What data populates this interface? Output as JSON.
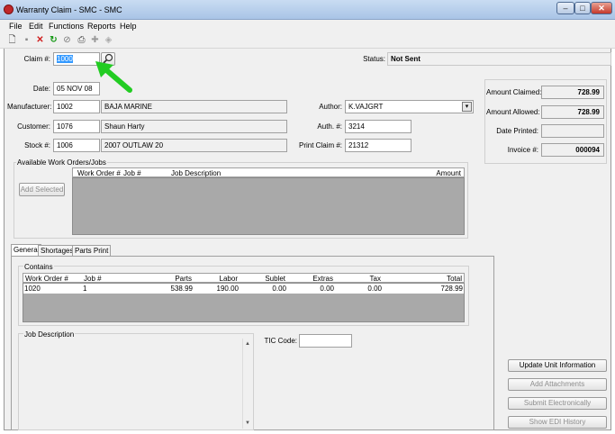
{
  "window": {
    "title": "Warranty Claim - SMC - SMC",
    "min": "–",
    "max": "□",
    "close": "✕"
  },
  "menu": {
    "file": "File",
    "edit": "Edit",
    "functions": "Functions",
    "reports": "Reports",
    "help": "Help"
  },
  "toolbar": {
    "new": "🗋",
    "save": "▪",
    "delete": "✕",
    "refresh": "↻",
    "cancel": "⊘",
    "print": "⎙",
    "add": "✚",
    "attach": "◈"
  },
  "header": {
    "claim_label": "Claim #:",
    "claim_value": "1000",
    "status_label": "Status:",
    "status_value": "Not Sent",
    "date_label": "Date:",
    "date_value": "05 NOV 08"
  },
  "info": {
    "manufacturer_label": "Manufacturer:",
    "manufacturer_code": "1002",
    "manufacturer_name": "BAJA MARINE",
    "customer_label": "Customer:",
    "customer_code": "1076",
    "customer_name": "Shaun Harty",
    "stock_label": "Stock #:",
    "stock_code": "1006",
    "stock_name": "2007 OUTLAW 20",
    "author_label": "Author:",
    "author_value": "K.VAJGRT",
    "auth_label": "Auth. #:",
    "auth_value": "3214",
    "print_claim_label": "Print Claim #:",
    "print_claim_value": "21312"
  },
  "amounts": {
    "claimed_label": "Amount Claimed:",
    "claimed_value": "728.99",
    "allowed_label": "Amount Allowed:",
    "allowed_value": "728.99",
    "date_printed_label": "Date Printed:",
    "date_printed_value": "",
    "invoice_label": "Invoice #:",
    "invoice_value": "000094"
  },
  "work_orders": {
    "title": "Available Work Orders/Jobs",
    "add_selected": "Add Selected",
    "columns": {
      "work_order": "Work Order #",
      "job": "Job #",
      "job_description": "Job Description",
      "amount": "Amount"
    }
  },
  "tabs": {
    "general": "General",
    "shortages": "Shortages",
    "parts_print": "Parts Print"
  },
  "contains": {
    "title": "Contains",
    "columns": {
      "work_order": "Work Order #",
      "job": "Job #",
      "parts": "Parts",
      "labor": "Labor",
      "sublet": "Sublet",
      "extras": "Extras",
      "tax": "Tax",
      "total": "Total"
    },
    "rows": [
      {
        "work_order": "1020",
        "job": "1",
        "parts": "538.99",
        "labor": "190.00",
        "sublet": "0.00",
        "extras": "0.00",
        "tax": "0.00",
        "total": "728.99"
      }
    ]
  },
  "job_description": {
    "label": "Job Description",
    "value": ""
  },
  "tic": {
    "label": "TIC Code:",
    "value": ""
  },
  "actions": {
    "update_unit": "Update Unit Information",
    "add_attachments": "Add Attachments",
    "submit_electronically": "Submit Electronically",
    "show_edi_history": "Show EDI History"
  },
  "colors": {
    "highlight": "#3399ff",
    "annotation_arrow": "#22cc22",
    "grid_empty": "#a9a9a9"
  }
}
